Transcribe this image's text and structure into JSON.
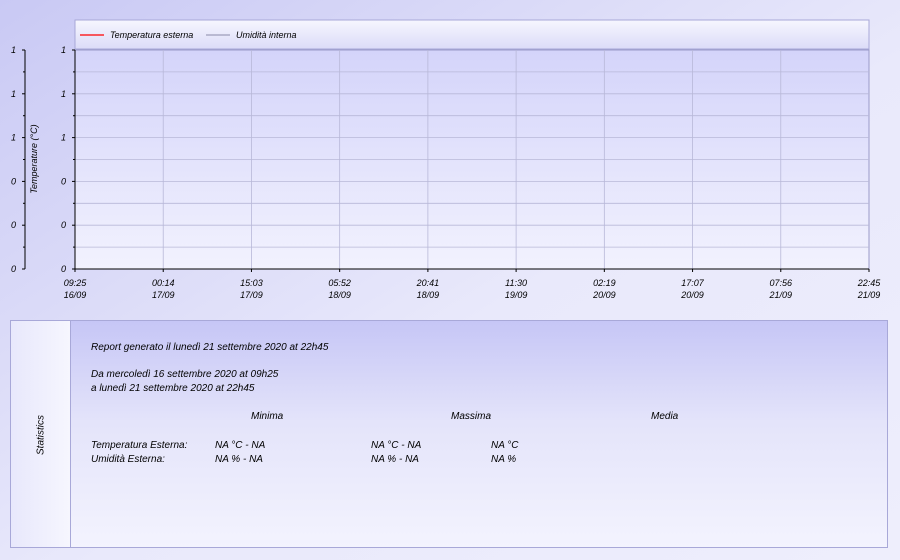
{
  "chart_data": {
    "type": "line",
    "ylabel": "Temperature (°C)",
    "x_ticks": [
      {
        "time": "09:25",
        "date": "16/09"
      },
      {
        "time": "00:14",
        "date": "17/09"
      },
      {
        "time": "15:03",
        "date": "17/09"
      },
      {
        "time": "05:52",
        "date": "18/09"
      },
      {
        "time": "20:41",
        "date": "18/09"
      },
      {
        "time": "11:30",
        "date": "19/09"
      },
      {
        "time": "02:19",
        "date": "20/09"
      },
      {
        "time": "17:07",
        "date": "20/09"
      },
      {
        "time": "07:56",
        "date": "21/09"
      },
      {
        "time": "22:45",
        "date": "21/09"
      }
    ],
    "y_ticks": [
      "0",
      "0",
      "0",
      "1",
      "1",
      "1"
    ],
    "series": [
      {
        "name": "Temperatura esterna",
        "color": "#ff0000",
        "values": []
      },
      {
        "name": "Umidità interna",
        "color": "#8a8aa8",
        "values": []
      }
    ],
    "grid": true,
    "legend_position": "top-left"
  },
  "stats": {
    "side_label": "Statistics",
    "report_line": "Report generato il lunedì 21 settembre 2020 at 22h45",
    "range_from": "Da mercoledì 16 settembre 2020 at 09h25",
    "range_to": "a lunedì 21 settembre 2020 at 22h45",
    "headers": {
      "min": "Minima",
      "max": "Massima",
      "avg": "Media"
    },
    "rows": [
      {
        "label": "Temperatura Esterna:",
        "min": "NA °C - NA",
        "max": "NA °C - NA",
        "avg": "NA °C"
      },
      {
        "label": "Umidità Esterna:",
        "min": "NA % - NA",
        "max": "NA % - NA",
        "avg": "NA %"
      }
    ]
  }
}
